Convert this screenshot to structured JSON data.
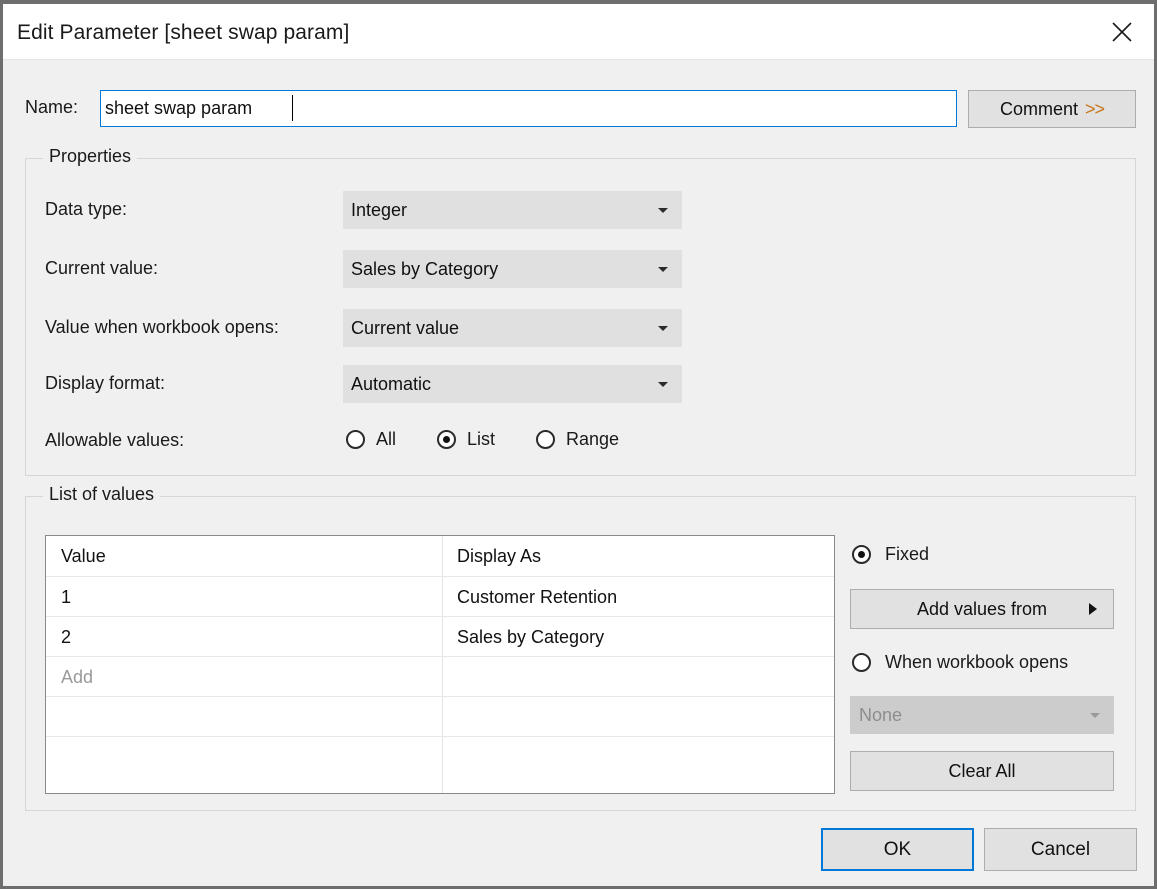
{
  "dialog": {
    "title": "Edit Parameter [sheet swap param]",
    "close_icon": "close-icon"
  },
  "name_row": {
    "label": "Name:",
    "value": "sheet swap param",
    "placeholder": "",
    "comment_button": "Comment",
    "comment_chevrons": ">>"
  },
  "properties": {
    "legend": "Properties",
    "rows": [
      {
        "label": "Data type:",
        "value": "Integer"
      },
      {
        "label": "Current value:",
        "value": "Sales by Category"
      },
      {
        "label": "Value when workbook opens:",
        "value": "Current value"
      },
      {
        "label": "Display format:",
        "value": "Automatic"
      }
    ],
    "allowable_values": {
      "label": "Allowable values:",
      "options": [
        {
          "label": "All",
          "selected": false
        },
        {
          "label": "List",
          "selected": true
        },
        {
          "label": "Range",
          "selected": false
        }
      ]
    }
  },
  "list_of_values": {
    "legend": "List of values",
    "columns": [
      "Value",
      "Display As"
    ],
    "rows": [
      {
        "value": "1",
        "display_as": "Customer Retention"
      },
      {
        "value": "2",
        "display_as": "Sales by Category"
      }
    ],
    "add_placeholder": "Add",
    "empty_rows": 2,
    "source_options": [
      {
        "label": "Fixed",
        "selected": true
      },
      {
        "label": "When workbook opens",
        "selected": false
      }
    ],
    "add_values_from_button": "Add values from",
    "workbook_opens_source": "None",
    "clear_all_button": "Clear All"
  },
  "footer": {
    "ok": "OK",
    "cancel": "Cancel"
  },
  "colors": {
    "accent": "#0078d7",
    "comment_chevron": "#c8761a",
    "dialog_bg": "#f0f0f0",
    "button_bg": "#e1e1e1",
    "combo_bg": "#e0e0e0",
    "disabled_combo_bg": "#cccccc"
  }
}
